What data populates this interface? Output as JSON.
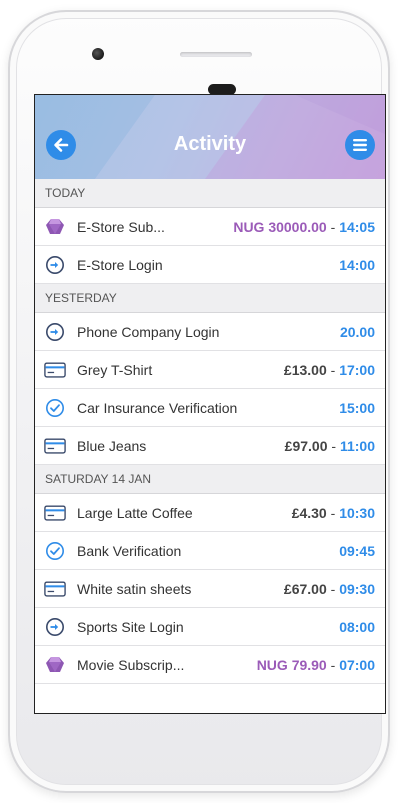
{
  "header": {
    "title": "Activity"
  },
  "colors": {
    "accent": "#2f8ce8",
    "nug": "#9b5bb8",
    "header_start": "#9fc2e4",
    "header_end": "#c9a7df"
  },
  "sections": [
    {
      "heading": "TODAY",
      "items": [
        {
          "icon": "gem-icon",
          "label": "E-Store Sub...",
          "amount": "NUG 30000.00",
          "time": "14:05"
        },
        {
          "icon": "login-icon",
          "label": "E-Store Login",
          "amount": "",
          "time": "14:00"
        }
      ]
    },
    {
      "heading": "YESTERDAY",
      "items": [
        {
          "icon": "login-icon",
          "label": "Phone Company Login",
          "amount": "",
          "time": "20.00"
        },
        {
          "icon": "card-icon",
          "label": "Grey T-Shirt",
          "amount": "£13.00",
          "time": "17:00"
        },
        {
          "icon": "check-icon",
          "label": "Car Insurance Verification",
          "amount": "",
          "time": "15:00"
        },
        {
          "icon": "card-icon",
          "label": "Blue Jeans",
          "amount": "£97.00",
          "time": "11:00"
        }
      ]
    },
    {
      "heading": "SATURDAY 14 JAN",
      "items": [
        {
          "icon": "card-icon",
          "label": "Large Latte Coffee",
          "amount": "£4.30",
          "time": "10:30"
        },
        {
          "icon": "check-icon",
          "label": "Bank Verification",
          "amount": "",
          "time": "09:45"
        },
        {
          "icon": "card-icon",
          "label": "White satin sheets",
          "amount": "£67.00",
          "time": "09:30"
        },
        {
          "icon": "login-icon",
          "label": "Sports Site Login",
          "amount": "",
          "time": "08:00"
        },
        {
          "icon": "gem-icon",
          "label": "Movie Subscrip...",
          "amount": "NUG 79.90",
          "time": "07:00"
        }
      ]
    }
  ]
}
